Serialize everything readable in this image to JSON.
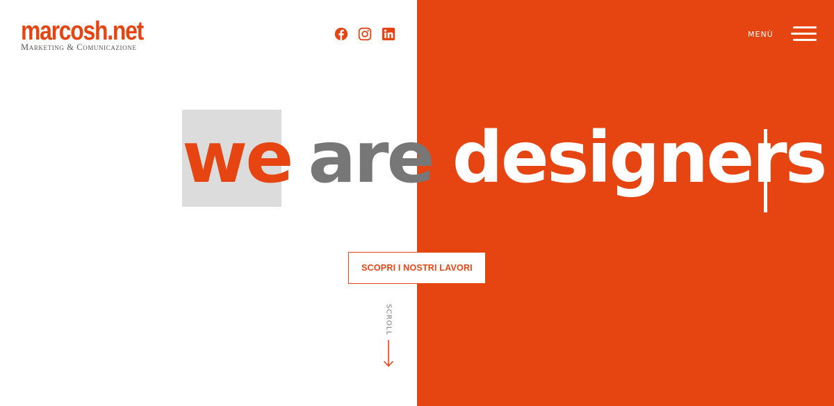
{
  "brand": {
    "name": "marcosh.net",
    "tagline_first": "Marketing",
    "tagline_amp": " & ",
    "tagline_second": "Comunicazione",
    "accent_color": "#e64512"
  },
  "social": [
    {
      "name": "facebook",
      "icon": "facebook-icon"
    },
    {
      "name": "instagram",
      "icon": "instagram-icon"
    },
    {
      "name": "linkedin",
      "icon": "linkedin-icon"
    }
  ],
  "menu": {
    "label": "MENÙ",
    "icon": "hamburger-icon"
  },
  "hero": {
    "word_1": "we",
    "word_2": "are",
    "word_3": "designers",
    "colors": {
      "word_1": "#e64512",
      "word_2": "#777777",
      "word_3": "#ffffff",
      "highlight": "#dcdcdc",
      "panel": "#e64512"
    }
  },
  "cta": {
    "label": "SCOPRI I NOSTRI LAVORI"
  },
  "scroll": {
    "label": "SCROLL",
    "icon": "arrow-down-icon"
  }
}
